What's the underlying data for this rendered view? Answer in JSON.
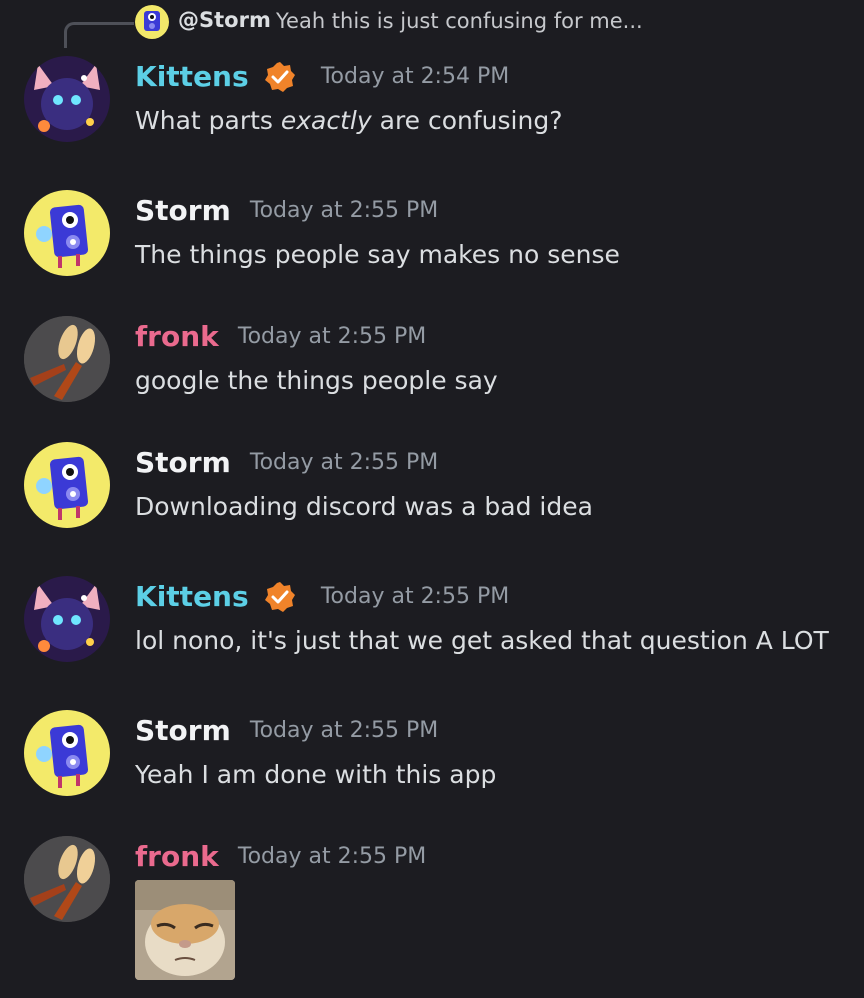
{
  "reply": {
    "username": "@Storm",
    "preview": "Yeah this is just confusing for me..."
  },
  "messages": [
    {
      "user": "Kittens",
      "time": "Today at 2:54 PM",
      "text_before": "What parts ",
      "text_em": "exactly",
      "text_after": " are confusing?"
    },
    {
      "user": "Storm",
      "time": "Today at 2:55 PM",
      "text": "The things people say makes no sense"
    },
    {
      "user": "fronk",
      "time": "Today at 2:55 PM",
      "text": "google the things people say"
    },
    {
      "user": "Storm",
      "time": "Today at 2:55 PM",
      "text": "Downloading discord was a bad idea"
    },
    {
      "user": "Kittens",
      "time": "Today at 2:55 PM",
      "text": "lol nono, it's just that we get asked that question A LOT"
    },
    {
      "user": "Storm",
      "time": "Today at 2:55 PM",
      "text": "Yeah I am done with this app"
    },
    {
      "user": "fronk",
      "time": "Today at 2:55 PM",
      "attachment": "cat-image"
    }
  ],
  "colors": {
    "background": "#1c1c21",
    "kittens": "#5ccfe6",
    "storm": "#f2f3f5",
    "fronk": "#ea6a8e",
    "timestamp": "#949ba4",
    "verified": "#f0832a"
  }
}
